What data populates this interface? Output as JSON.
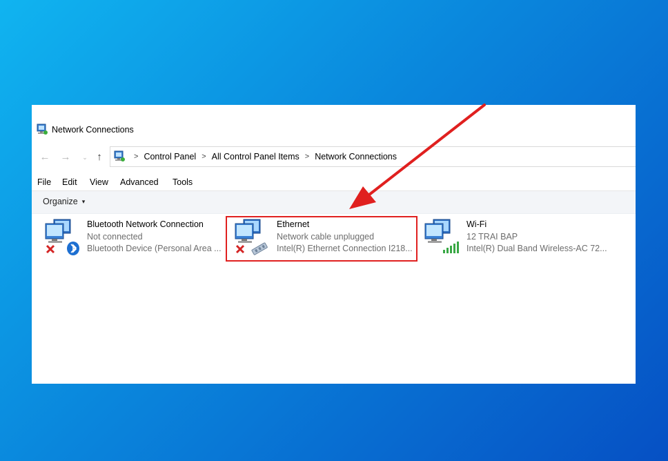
{
  "window": {
    "title": "Network Connections",
    "title_icon": "network-connections-icon"
  },
  "nav": {
    "back_icon": "back-arrow-icon",
    "forward_icon": "forward-arrow-icon",
    "recent_icon": "chevron-down-icon",
    "up_icon": "up-arrow-icon"
  },
  "address": {
    "crumbs": [
      "Control Panel",
      "All Control Panel Items",
      "Network Connections"
    ]
  },
  "menu": {
    "file": "File",
    "edit": "Edit",
    "view": "View",
    "advanced": "Advanced",
    "tools": "Tools"
  },
  "command_bar": {
    "organize": "Organize",
    "organize_caret": "▾"
  },
  "connections": [
    {
      "name": "Bluetooth Network Connection",
      "status": "Not connected",
      "device": "Bluetooth Device (Personal Area ...",
      "icon": "bluetooth-network-icon",
      "state": "disconnected"
    },
    {
      "name": "Ethernet",
      "status": "Network cable unplugged",
      "device": "Intel(R) Ethernet Connection I218...",
      "icon": "ethernet-network-icon",
      "state": "disconnected",
      "highlighted": true
    },
    {
      "name": "Wi-Fi",
      "status": "12 TRAI BAP",
      "device": "Intel(R) Dual Band Wireless-AC 72...",
      "icon": "wifi-network-icon",
      "state": "connected"
    }
  ],
  "annotation": {
    "highlight_color": "#e0201f",
    "arrow_color": "#e0201f"
  },
  "colors": {
    "bg_start": "#10b4f0",
    "bg_end": "#0650c4",
    "status_text": "#6d6d6d"
  }
}
